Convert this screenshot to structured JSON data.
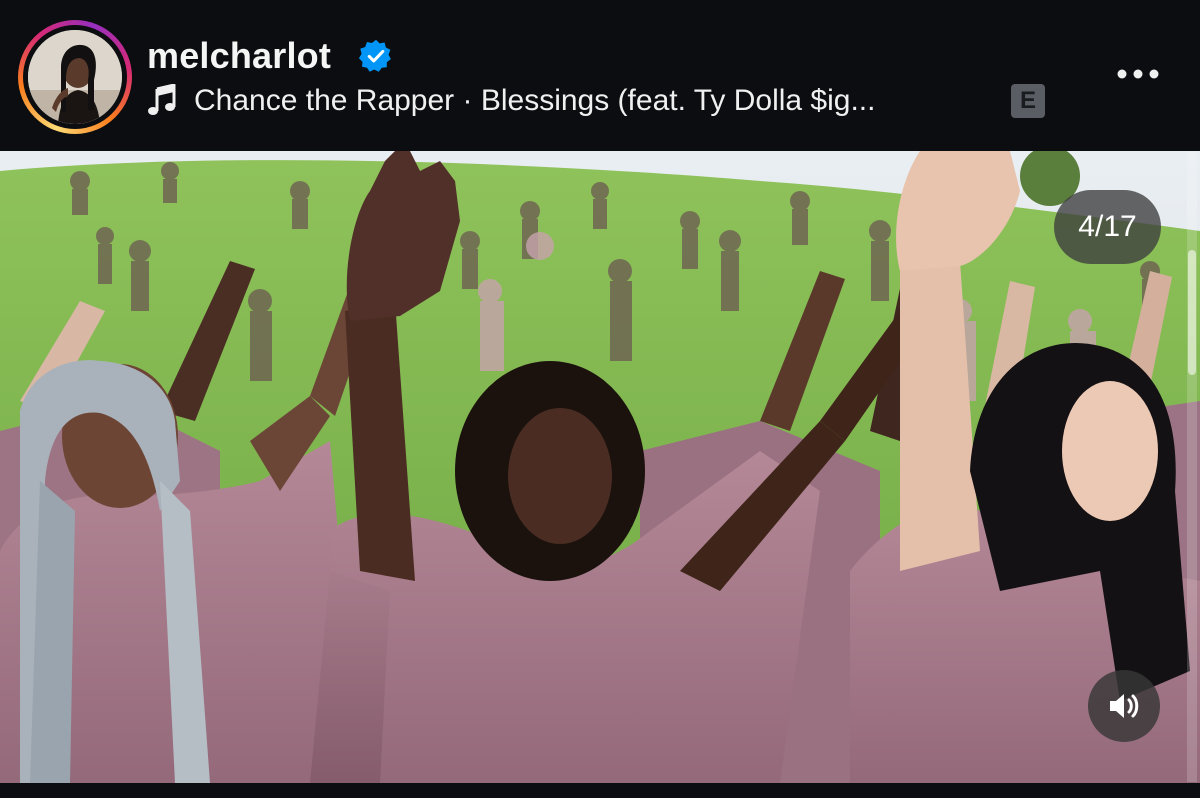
{
  "post": {
    "username": "melcharlot",
    "verified": true,
    "song_label": "Chance the Rapper · Blessings (feat. Ty Dolla $ig...",
    "explicit_badge": "E",
    "more_icon": "more-horizontal-icon",
    "music_icon": "music-note-icon"
  },
  "media": {
    "counter": "4/17",
    "audio_icon": "speaker-icon"
  },
  "colors": {
    "background": "#0b0d10",
    "text": "#f5f5f5",
    "verified_blue": "#0095f6",
    "badge_bg": "#5a5e64",
    "shirt_mauve": "#a77d8c"
  }
}
